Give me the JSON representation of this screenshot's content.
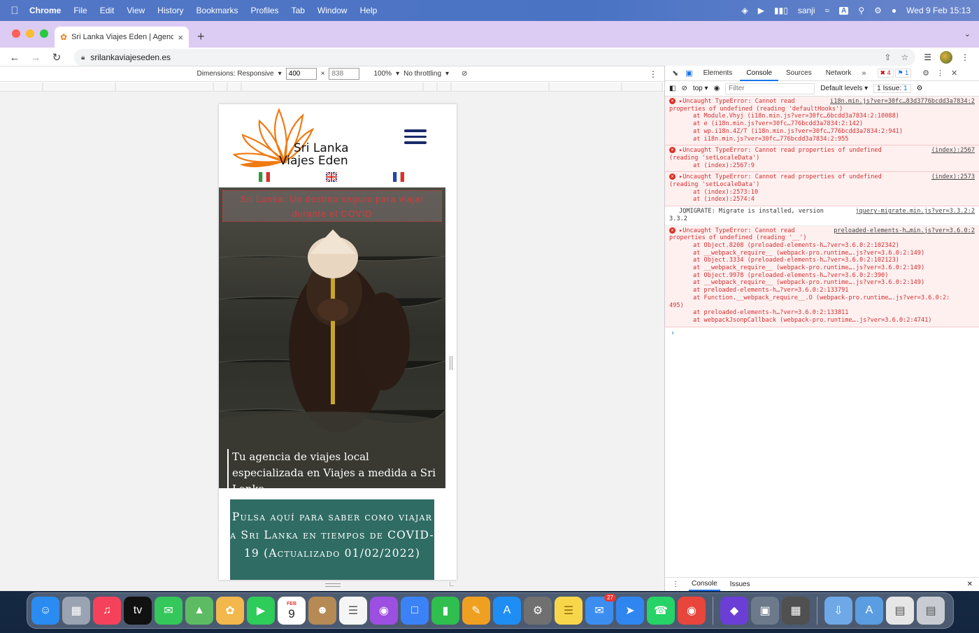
{
  "menubar": {
    "app": "Chrome",
    "items": [
      "File",
      "Edit",
      "View",
      "History",
      "Bookmarks",
      "Profiles",
      "Tab",
      "Window",
      "Help"
    ],
    "user": "sanji",
    "datetime": "Wed 9 Feb  15:13",
    "input_source": "A"
  },
  "tab": {
    "title": "Sri Lanka Viajes Eden | Agencia",
    "close": "×",
    "new": "+"
  },
  "address": {
    "url": "srilankaviajeseden.es"
  },
  "device_toolbar": {
    "dimensions_label": "Dimensions: Responsive",
    "width": "400",
    "times": "×",
    "height": "838",
    "zoom": "100%",
    "throttling": "No throttling"
  },
  "page": {
    "logo_line1": "Sri Lanka",
    "logo_line2": "Viajes Eden",
    "banner": "Sri Lanka: Un destino seguro para viajar durante el COVID",
    "caption": "Tu agencia de viajes local especializada en Viajes a medida a Sri Lanka",
    "cta": "Pulsa aquí para saber como viajar a Sri Lanka en tiempos de COVID-19 (Actualizado 01/02/2022)",
    "flags": [
      "Italian flag",
      "UK flag",
      "French flag"
    ]
  },
  "devtools": {
    "tabs": [
      "Elements",
      "Console",
      "Sources",
      "Network"
    ],
    "active_tab": "Console",
    "more": "»",
    "error_count": "4",
    "issue_count": "1",
    "context": "top",
    "filter_placeholder": "Filter",
    "levels": "Default levels",
    "issues_label": "1 Issue:",
    "issues_num": "1",
    "drawer_tabs": [
      "Console",
      "Issues"
    ],
    "entries": [
      {
        "type": "error",
        "head": "Uncaught TypeError: Cannot read",
        "src": "i18n.min.js?ver=30fc…83d3776bcdd3a7834:2",
        "lines": [
          "properties of undefined (reading 'defaultHooks')"
        ],
        "stack": [
          "at Module.Vhyj (i18n.min.js?ver=30fc…6bcdd3a7834:2:10088)",
          "at e (i18n.min.js?ver=30fc…776bcdd3a7834:2:142)",
          "at wp.i18n.4Z/T (i18n.min.js?ver=30fc…776bcdd3a7834:2:941)",
          "at i18n.min.js?ver=30fc…776bcdd3a7834:2:955"
        ]
      },
      {
        "type": "error",
        "head": "Uncaught TypeError: Cannot read properties of undefined",
        "src": "(index):2567",
        "lines": [
          "(reading 'setLocaleData')"
        ],
        "stack": [
          "at (index):2567:9"
        ]
      },
      {
        "type": "error",
        "head": "Uncaught TypeError: Cannot read properties of undefined",
        "src": "(index):2573",
        "lines": [
          "(reading 'setLocaleData')"
        ],
        "stack": [
          "at (index):2573:10",
          "at (index):2574:4"
        ]
      },
      {
        "type": "info",
        "head": "JQMIGRATE: Migrate is installed, version",
        "src": "jquery-migrate.min.js?ver=3.3.2:2",
        "lines": [
          "3.3.2"
        ],
        "stack": []
      },
      {
        "type": "error",
        "head": "Uncaught TypeError: Cannot read",
        "src": "preloaded-elements-h…min.js?ver=3.6.0:2",
        "lines": [
          "properties of undefined (reading '__')"
        ],
        "stack": [
          "at Object.8208 (preloaded-elements-h…?ver=3.6.0:2:102342)",
          "at __webpack_require__ (webpack-pro.runtime….js?ver=3.6.0:2:149)",
          "at Object.3334 (preloaded-elements-h…?ver=3.6.0:2:102123)",
          "at __webpack_require__ (webpack-pro.runtime….js?ver=3.6.0:2:149)",
          "at Object.9978 (preloaded-elements-h…?ver=3.6.0:2:390)",
          "at __webpack_require__ (webpack-pro.runtime….js?ver=3.6.0:2:149)",
          "at preloaded-elements-h…?ver=3.6.0:2:133791",
          "at Function.__webpack_require__.O (webpack-pro.runtime….js?ver=3.6.0:2:",
          "495)",
          "at preloaded-elements-h…?ver=3.6.0:2:133811",
          "at webpackJsonpCallback (webpack-pro.runtime….js?ver=3.6.0:2:4741)"
        ]
      }
    ],
    "prompt": "›"
  },
  "dock": {
    "calendar_month": "FEB",
    "calendar_day": "9",
    "mail_badge": "27",
    "apps": [
      {
        "name": "finder",
        "color": "#2a8cf0"
      },
      {
        "name": "launchpad",
        "color": "#9aa3b2"
      },
      {
        "name": "music",
        "color": "#f5425a"
      },
      {
        "name": "tv",
        "color": "#111111"
      },
      {
        "name": "messages",
        "color": "#34c759"
      },
      {
        "name": "maps",
        "color": "#5dbb63"
      },
      {
        "name": "photos",
        "color": "#f2b84b"
      },
      {
        "name": "facetime",
        "color": "#2ecc58"
      },
      {
        "name": "calendar",
        "color": "#ffffff"
      },
      {
        "name": "contacts",
        "color": "#b58a55"
      },
      {
        "name": "reminders",
        "color": "#f5f5f5"
      },
      {
        "name": "podcasts",
        "color": "#9c4fe0"
      },
      {
        "name": "keynote",
        "color": "#3b82f6"
      },
      {
        "name": "numbers",
        "color": "#2fbf4e"
      },
      {
        "name": "pages",
        "color": "#f0a020"
      },
      {
        "name": "app-store",
        "color": "#1e8ef5"
      },
      {
        "name": "system-preferences",
        "color": "#707070"
      },
      {
        "name": "notes",
        "color": "#f7d64a"
      },
      {
        "name": "mail",
        "color": "#3b8ef0"
      },
      {
        "name": "safari",
        "color": "#2f86f0"
      },
      {
        "name": "whatsapp",
        "color": "#25d366"
      },
      {
        "name": "chrome",
        "color": "#e8453c"
      },
      {
        "name": "shortcuts",
        "color": "#6b3fd6"
      },
      {
        "name": "preview",
        "color": "#6c7a8c"
      },
      {
        "name": "calculator",
        "color": "#505050"
      },
      {
        "name": "downloads-folder",
        "color": "#6ea8e6"
      },
      {
        "name": "applications-folder",
        "color": "#5a9de0"
      },
      {
        "name": "document",
        "color": "#e6e6e6"
      },
      {
        "name": "trash",
        "color": "#c8ccd2"
      }
    ]
  }
}
